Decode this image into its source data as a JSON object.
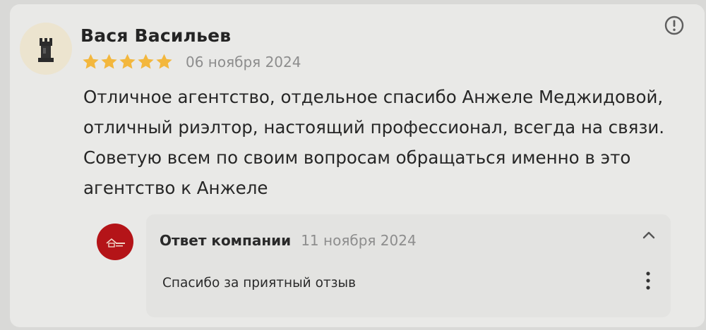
{
  "review": {
    "author": "Вася Васильев",
    "rating": 5,
    "rating_max": 5,
    "date": "06 ноября 2024",
    "text_lines": [
      "Отличное агентство, отдельное спасибо Анжеле Меджидовой,",
      "отличный риэлтор, настоящий профессионал, всегда на связи.",
      "Советую всем по своим вопросам обращаться именно в это",
      "агентство к Анжеле"
    ],
    "avatar_icon": "chess-rook-icon",
    "report_icon": "exclamation-circle-icon"
  },
  "company_reply": {
    "title": "Ответ компании",
    "date": "11 ноября 2024",
    "text": "Спасибо за приятный отзыв",
    "logo_icon": "house-logo-icon",
    "collapse_icon": "chevron-up-icon",
    "menu_icon": "more-vertical-icon"
  },
  "colors": {
    "star": "#f3b73d",
    "company_logo_bg": "#b41418",
    "muted_text": "#8d8d8d",
    "reply_bg": "#e3e3e1"
  }
}
